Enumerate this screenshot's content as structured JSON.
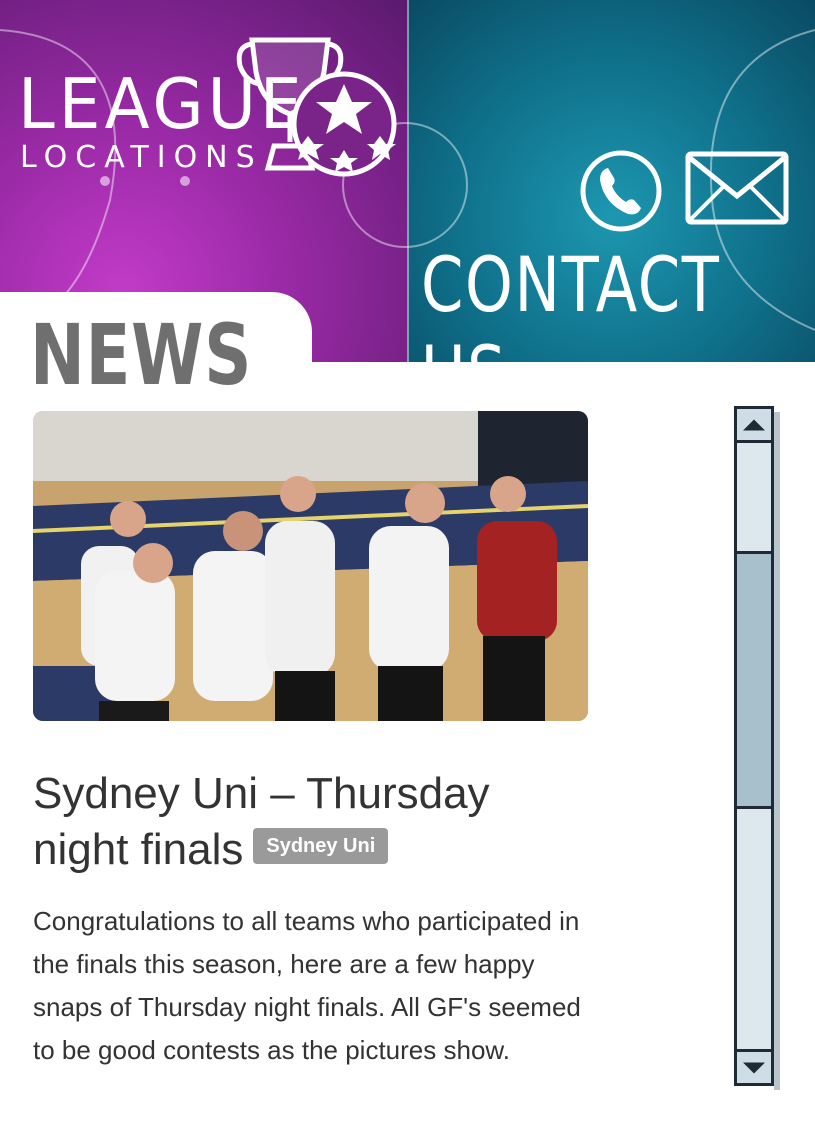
{
  "header": {
    "logo_word_1": "LEAGUE",
    "logo_word_2": "LOCATIONS",
    "contact_label": "CONTACT US",
    "left_color": "#9a2aa6",
    "right_color": "#0f6f89"
  },
  "section": {
    "title": "NEWS"
  },
  "article": {
    "title": "Sydney Uni – Thursday night finals",
    "tag": "Sydney Uni",
    "body": "Congratulations to all teams who participated in the finals this season, here are a few happy snaps of Thursday night finals. All GF's seemed to be good contests as the pictures show."
  },
  "scrollbar": {
    "position": 0.0
  }
}
